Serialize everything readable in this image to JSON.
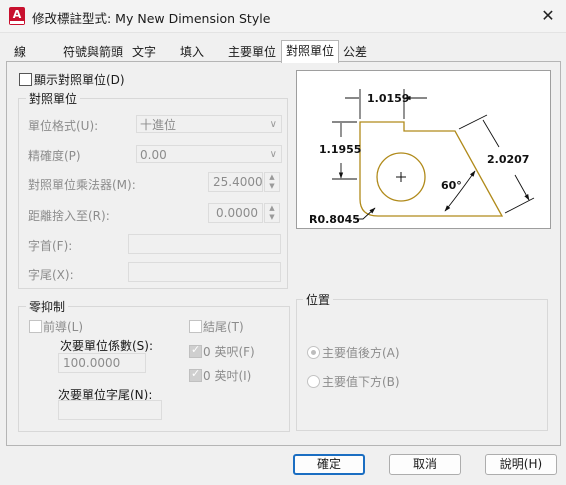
{
  "window": {
    "title": "修改標註型式: My New Dimension Style",
    "app_icon_letter": "A",
    "close_glyph": "✕"
  },
  "tabs": [
    {
      "label": "線"
    },
    {
      "label": "符號與箭頭"
    },
    {
      "label": "文字"
    },
    {
      "label": "填入"
    },
    {
      "label": "主要單位"
    },
    {
      "label": "對照單位"
    },
    {
      "label": "公差"
    }
  ],
  "alt": {
    "display_label": "顯示對照單位(D)",
    "units_group": "對照單位",
    "unit_format_label": "單位格式(U):",
    "unit_format_value": "十進位",
    "precision_label": "精確度(P)",
    "precision_value": "0.00",
    "multiplier_label": "對照單位乘法器(M):",
    "multiplier_value": "25.4000",
    "round_label": "距離捨入至(R):",
    "round_value": "0.0000",
    "prefix_label": "字首(F):",
    "suffix_label": "字尾(X):"
  },
  "zero": {
    "group": "零抑制",
    "leading_label": "前導(L)",
    "trailing_label": "結尾(T)",
    "subunit_factor_label": "次要單位係數(S):",
    "subunit_factor_value": "100.0000",
    "subunit_suffix_label": "次要單位字尾(N):",
    "feet_label": "0 英呎(F)",
    "inches_label": "0 英吋(I)"
  },
  "placement": {
    "group": "位置",
    "after_label": "主要值後方(A)",
    "below_label": "主要值下方(B)"
  },
  "preview": {
    "dim_top": "1.0159",
    "dim_left": "1.1955",
    "dim_right": "2.0207",
    "angle": "60°",
    "radius": "R0.8045"
  },
  "buttons": {
    "ok": "確定",
    "cancel": "取消",
    "help": "說明(H)"
  },
  "colors": {
    "accent": "#1b6ec2",
    "brand": "#c8102e",
    "shape": "#b08a1a"
  }
}
